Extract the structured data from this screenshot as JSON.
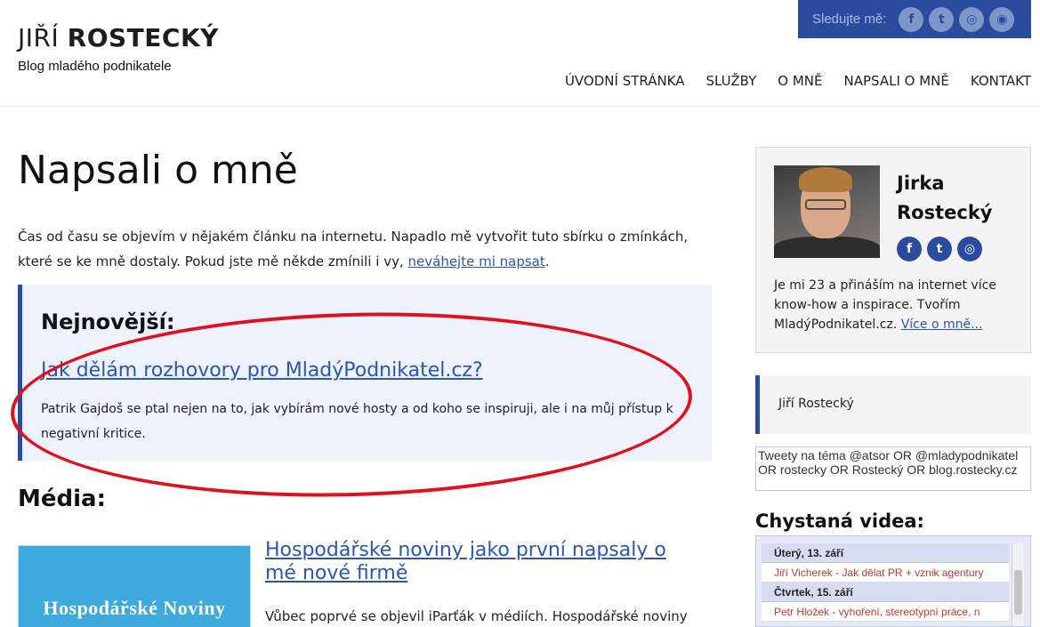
{
  "header": {
    "logo_first": "JIŘÍ",
    "logo_last": "ROSTECKÝ",
    "tagline": "Blog mladého podnikatele",
    "follow_label": "Sledujte mě:",
    "social_icons": [
      "facebook-icon",
      "twitter-icon",
      "instagram-icon",
      "rss-icon"
    ],
    "social_glyphs": [
      "f",
      "t",
      "◎",
      "◉"
    ],
    "nav": [
      "ÚVODNÍ STRÁNKA",
      "SLUŽBY",
      "O MNĚ",
      "NAPSALI O MNĚ",
      "KONTAKT"
    ]
  },
  "main": {
    "title": "Napsali o mně",
    "intro_text": "Čas od času se objevím v nějakém článku na internetu. Napadlo mě vytvořit tuto sbírku o zmínkách, které se ke mně dostaly. Pokud jste mě někde zmínili i vy, ",
    "intro_link": "neváhejte mi napsat",
    "intro_end": ".",
    "latest": {
      "heading": "Nejnovější:",
      "link": "Jak dělám rozhovory pro MladýPodnikatel.cz?",
      "description": "Patrik Gajdoš se ptal nejen na to, jak vybírám nové hosty a od koho se inspiruji, ale i na můj přístup k negativní kritice."
    },
    "media": {
      "heading": "Média:",
      "thumb_text": "Hospodářské Noviny",
      "title": "Hospodářské noviny jako první napsaly o mé nové firmě",
      "excerpt": "Vůbec poprvé se objevil iParťák v médiích. Hospodářské noviny"
    }
  },
  "sidebar": {
    "profile": {
      "name": "Jirka Rostecký",
      "social_glyphs": [
        "f",
        "t",
        "◎"
      ],
      "bio": "Je mi 23 a přináším na internet více know-how a inspirace. Tvořím MladýPodnikatel.cz. ",
      "bio_link": "Více o mně..."
    },
    "twitter_label": "Jiří Rostecký",
    "tweets_widget_text": "Tweety na téma @atsor OR @mladypodnikatel OR rostecky OR Rostecký OR blog.rostecky.cz",
    "videos": {
      "heading": "Chystaná videa:",
      "rows": [
        {
          "date": "Úterý, 13. září",
          "event": "Jiří Vicherek - Jak dělat PR + vznik agentury"
        },
        {
          "date": "Čtvrtek, 15. září",
          "event": "Petr Hložek - vyhoření, stereotypní práce, n"
        }
      ]
    }
  },
  "colors": {
    "brand_blue": "#2b4c9e",
    "link_blue": "#2a56b0",
    "highlight_red": "#e0101c",
    "box_bg": "#eef2fc"
  }
}
